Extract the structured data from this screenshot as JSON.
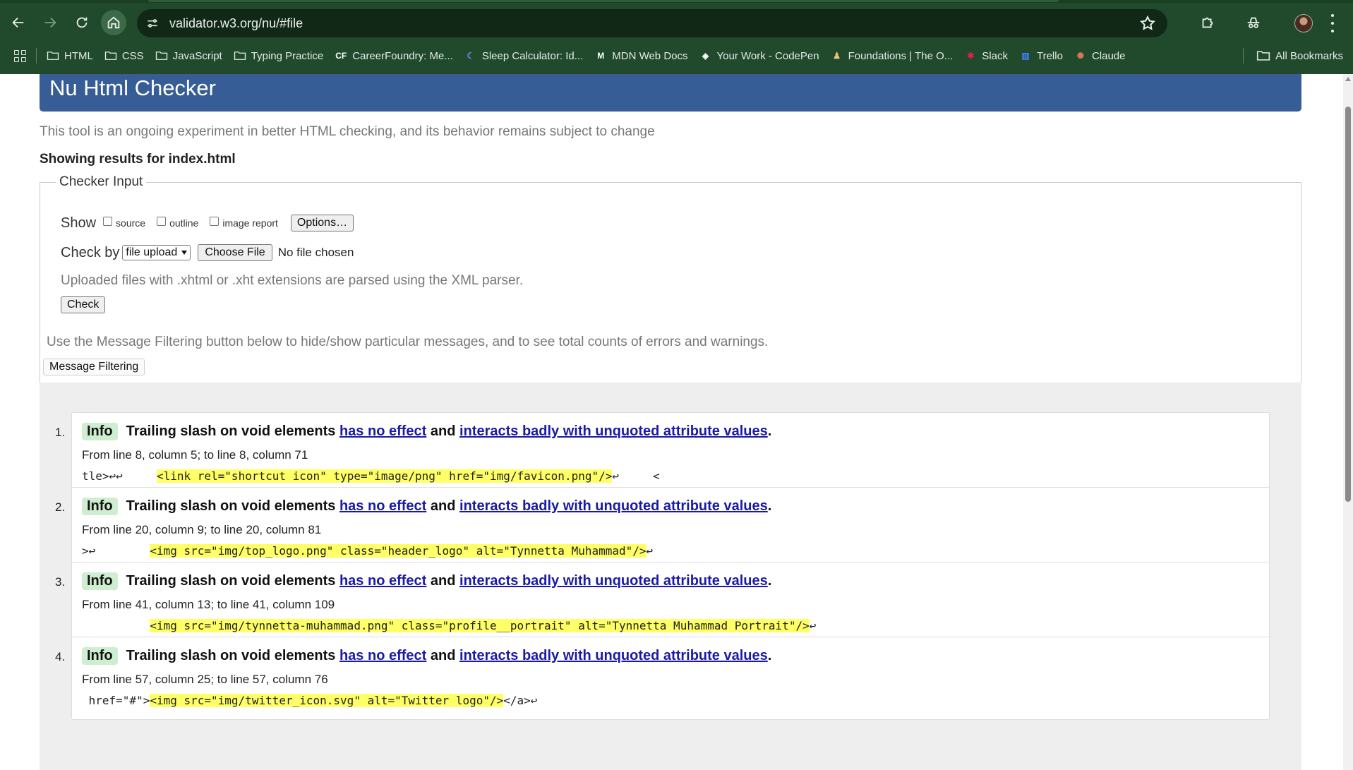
{
  "browser": {
    "url": "validator.w3.org/nu/#file",
    "bookmarks": [
      {
        "label": "HTML",
        "icon": "folder-icon"
      },
      {
        "label": "CSS",
        "icon": "folder-icon"
      },
      {
        "label": "JavaScript",
        "icon": "folder-icon"
      },
      {
        "label": "Typing Practice",
        "icon": "folder-icon"
      },
      {
        "label": "CareerFoundry: Me...",
        "icon": "careerfoundry-icon"
      },
      {
        "label": "Sleep Calculator: Id...",
        "icon": "sleep-icon"
      },
      {
        "label": "MDN Web Docs",
        "icon": "mdn-icon"
      },
      {
        "label": "Your Work - CodePen",
        "icon": "codepen-icon"
      },
      {
        "label": "Foundations | The O...",
        "icon": "odin-icon"
      },
      {
        "label": "Slack",
        "icon": "slack-icon"
      },
      {
        "label": "Trello",
        "icon": "trello-icon"
      },
      {
        "label": "Claude",
        "icon": "claude-icon"
      }
    ],
    "all_bookmarks": "All Bookmarks"
  },
  "page": {
    "title": "Nu Html Checker",
    "intro": "This tool is an ongoing experiment in better HTML checking, and its behavior remains subject to change",
    "showing": "Showing results for index.html",
    "checker_input": {
      "legend": "Checker Input",
      "show_label": "Show",
      "checkboxes": [
        "source",
        "outline",
        "image report"
      ],
      "options_button": "Options…",
      "check_by_label": "Check by",
      "check_by_value": "file upload",
      "choose_file": "Choose File",
      "no_file": "No file chosen",
      "upload_note": "Uploaded files with .xhtml or .xht extensions are parsed using the XML parser.",
      "check_button": "Check"
    },
    "filter_note": "Use the Message Filtering button below to hide/show particular messages, and to see total counts of errors and warnings.",
    "filter_button": "Message Filtering",
    "messages": [
      {
        "num": "1.",
        "badge": "Info",
        "text_a": "Trailing slash on void elements",
        "link_1": "has no effect",
        "text_b": "and",
        "link_2": "interacts badly with unquoted attribute values",
        "text_c": ".",
        "location": "From line 8, column 5; to line 8, column 71",
        "code_pre": "tle>↩↩     ",
        "code_hl": "<link rel=\"shortcut icon\" type=\"image/png\" href=\"img/favicon.png\"/>",
        "code_post": "↩     <"
      },
      {
        "num": "2.",
        "badge": "Info",
        "text_a": "Trailing slash on void elements",
        "link_1": "has no effect",
        "text_b": "and",
        "link_2": "interacts badly with unquoted attribute values",
        "text_c": ".",
        "location": "From line 20, column 9; to line 20, column 81",
        "code_pre": ">↩        ",
        "code_hl": "<img src=\"img/top_logo.png\" class=\"header_logo\" alt=\"Tynnetta Muhammad\"/>",
        "code_post": "↩"
      },
      {
        "num": "3.",
        "badge": "Info",
        "text_a": "Trailing slash on void elements",
        "link_1": "has no effect",
        "text_b": "and",
        "link_2": "interacts badly with unquoted attribute values",
        "text_c": ".",
        "location": "From line 41, column 13; to line 41, column 109",
        "code_pre": "          ",
        "code_hl": "<img src=\"img/tynnetta-muhammad.png\" class=\"profile__portrait\" alt=\"Tynnetta Muhammad Portrait\"/>",
        "code_post": "↩"
      },
      {
        "num": "4.",
        "badge": "Info",
        "text_a": "Trailing slash on void elements",
        "link_1": "has no effect",
        "text_b": "and",
        "link_2": "interacts badly with unquoted attribute values",
        "text_c": ".",
        "location": "From line 57, column 25; to line 57, column 76",
        "code_pre": " href=\"#\">",
        "code_hl": "<img src=\"img/twitter_icon.svg\" alt=\"Twitter logo\"/>",
        "code_post": "</a>↩"
      }
    ]
  }
}
